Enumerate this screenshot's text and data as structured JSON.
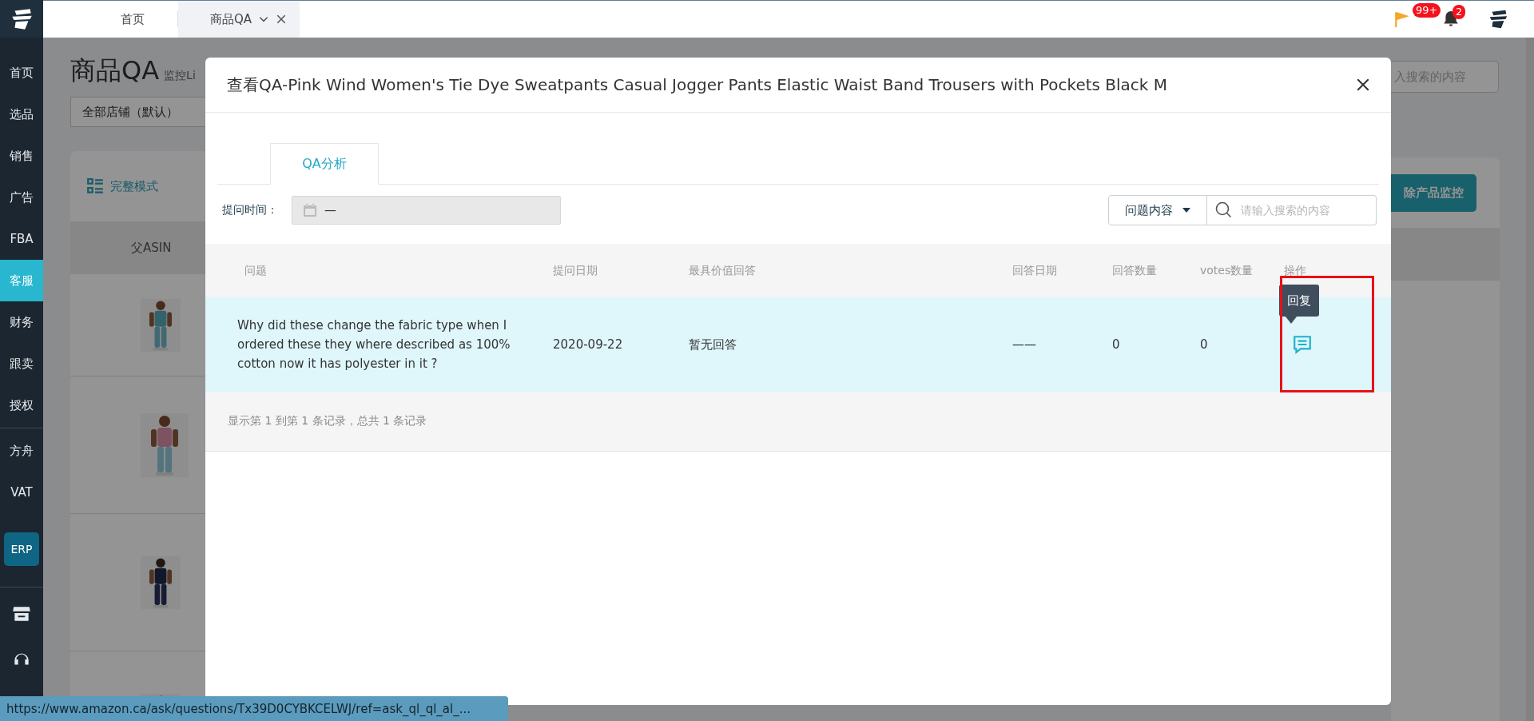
{
  "sidebar": {
    "items": [
      {
        "label": "首页",
        "selected": false
      },
      {
        "label": "选品",
        "selected": false
      },
      {
        "label": "销售",
        "selected": false
      },
      {
        "label": "广告",
        "selected": false
      },
      {
        "label": "FBA",
        "selected": false
      },
      {
        "label": "客服",
        "selected": true
      },
      {
        "label": "财务",
        "selected": false
      },
      {
        "label": "跟卖",
        "selected": false
      },
      {
        "label": "授权",
        "selected": false
      }
    ],
    "extra_items": [
      {
        "label": "方舟"
      },
      {
        "label": "VAT"
      }
    ],
    "erp_button": "ERP"
  },
  "top_tabs": [
    {
      "label": "首页",
      "selected": false,
      "closable": false
    },
    {
      "label": "商品QA",
      "selected": true,
      "closable": true
    }
  ],
  "notifications": {
    "flag_badge": "99+",
    "bell_badge": "2"
  },
  "page": {
    "title": "商品QA",
    "subtitle": "监控Li",
    "store_select": "全部店铺（默认）",
    "view_mode": "完整模式",
    "search_placeholder": "入搜索的内容",
    "remove_button": "除产品监控",
    "column_header": "父ASIN"
  },
  "modal": {
    "title": "查看QA-Pink Wind Women's Tie Dye Sweatpants Casual Jogger Pants Elastic Waist Band Trousers with Pockets Black M",
    "tabs": [
      {
        "label": "QA分析",
        "selected": true
      }
    ],
    "filter": {
      "label": "提问时间：",
      "date_value": "—"
    },
    "search": {
      "field_select": "问题内容",
      "placeholder": "请输入搜索的内容"
    },
    "table": {
      "columns": [
        "问题",
        "提问日期",
        "最具价值回答",
        "回答日期",
        "回答数量",
        "votes数量",
        "操作"
      ],
      "rows": [
        {
          "question": "Why did these change the fabric type when I ordered these they where described as 100% cotton now it has polyester in it ?",
          "date": "2020-09-22",
          "best_answer": "暂无回答",
          "answer_date": "——",
          "answer_count": "0",
          "votes": "0",
          "action_tooltip": "回复",
          "hovered": true,
          "action_highlighted": true
        }
      ]
    },
    "footer": "显示第 1 到第 1 条记录，总共 1 条记录"
  },
  "status_url": "https://www.amazon.ca/ask/questions/Tx39D0CYBKCELWJ/ref=ask_ql_ql_al_..."
}
